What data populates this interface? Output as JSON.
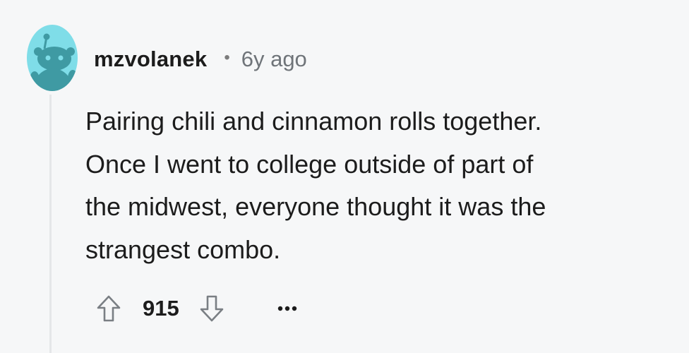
{
  "comment": {
    "author": "mzvolanek",
    "separator": "•",
    "age": "6y ago",
    "body_lines": [
      "Pairing chili and cinnamon rolls together.",
      "Once I went to college outside of part of",
      "the midwest, everyone thought it was the",
      "strangest combo."
    ],
    "score": "915"
  },
  "icons": {
    "avatar": "reddit-snoo-avatar",
    "upvote": "arrow-up-outline-icon",
    "downvote": "arrow-down-outline-icon",
    "more": "ellipsis-icon"
  },
  "colors": {
    "avatar_bg": "#7fdde8",
    "avatar_figure": "#3f9aa3",
    "text": "#1c1c1c",
    "muted": "#6f7479",
    "thread_line": "#e5e7e9"
  }
}
